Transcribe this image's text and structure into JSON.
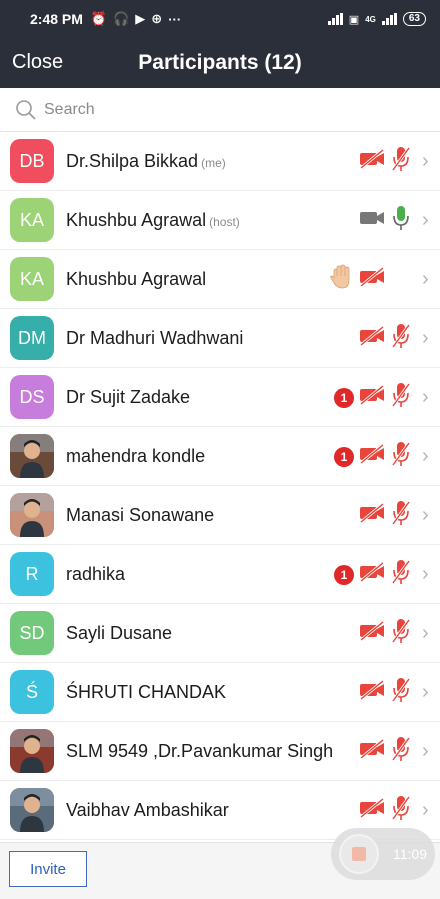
{
  "statusbar": {
    "time": "2:48 PM",
    "extra": "···",
    "network": "4G",
    "battery": "63"
  },
  "header": {
    "close_label": "Close",
    "title": "Participants (12)"
  },
  "search": {
    "placeholder": "Search"
  },
  "participants": [
    {
      "initials": "DB",
      "name": "Dr.Shilpa Bikkad",
      "tag": "(me)",
      "color": "#f04e5e",
      "video": "muted",
      "mic": "muted"
    },
    {
      "initials": "KA",
      "name": "Khushbu Agrawal",
      "tag": "(host)",
      "color": "#9bd376",
      "video": "on",
      "mic": "on"
    },
    {
      "initials": "KA",
      "name": "Khushbu Agrawal",
      "tag": "",
      "color": "#9bd376",
      "raised_hand": true,
      "video": "muted",
      "mic": "none"
    },
    {
      "initials": "DM",
      "name": "Dr Madhuri Wadhwani",
      "tag": "",
      "color": "#36aeaa",
      "video": "muted",
      "mic": "muted"
    },
    {
      "initials": "DS",
      "name": "Dr Sujit Zadake",
      "tag": "",
      "color": "#c67ddb",
      "badge": "1",
      "video": "muted",
      "mic": "muted"
    },
    {
      "initials": "",
      "photo": true,
      "name": "mahendra kondle",
      "tag": "",
      "color": "#6a4b3a",
      "badge": "1",
      "video": "muted",
      "mic": "muted"
    },
    {
      "initials": "",
      "photo": true,
      "name": "Manasi Sonawane",
      "tag": "",
      "color": "#c9907a",
      "video": "muted",
      "mic": "muted"
    },
    {
      "initials": "R",
      "name": "radhika",
      "tag": "",
      "color": "#3cc2de",
      "badge": "1",
      "video": "muted",
      "mic": "muted"
    },
    {
      "initials": "SD",
      "name": "Sayli Dusane",
      "tag": "",
      "color": "#72c97c",
      "video": "muted",
      "mic": "muted"
    },
    {
      "initials": "Ś",
      "name": "ŚHRUTI CHANDAK",
      "tag": "",
      "color": "#3cc2de",
      "video": "muted",
      "mic": "muted"
    },
    {
      "initials": "",
      "photo": true,
      "name": "SLM 9549 ,Dr.Pavankumar Singh",
      "tag": "",
      "color": "#8a3b2e",
      "video": "muted",
      "mic": "muted"
    },
    {
      "initials": "",
      "photo": true,
      "name": "Vaibhav Ambashikar",
      "tag": "",
      "color": "#5a6b7c",
      "video": "muted",
      "mic": "muted"
    }
  ],
  "footer": {
    "invite_label": "Invite",
    "timer": "11:09"
  },
  "colors": {
    "header_bg": "#2b2f3a",
    "muted_red": "#e8453c",
    "accent_blue": "#2c5fc0"
  }
}
